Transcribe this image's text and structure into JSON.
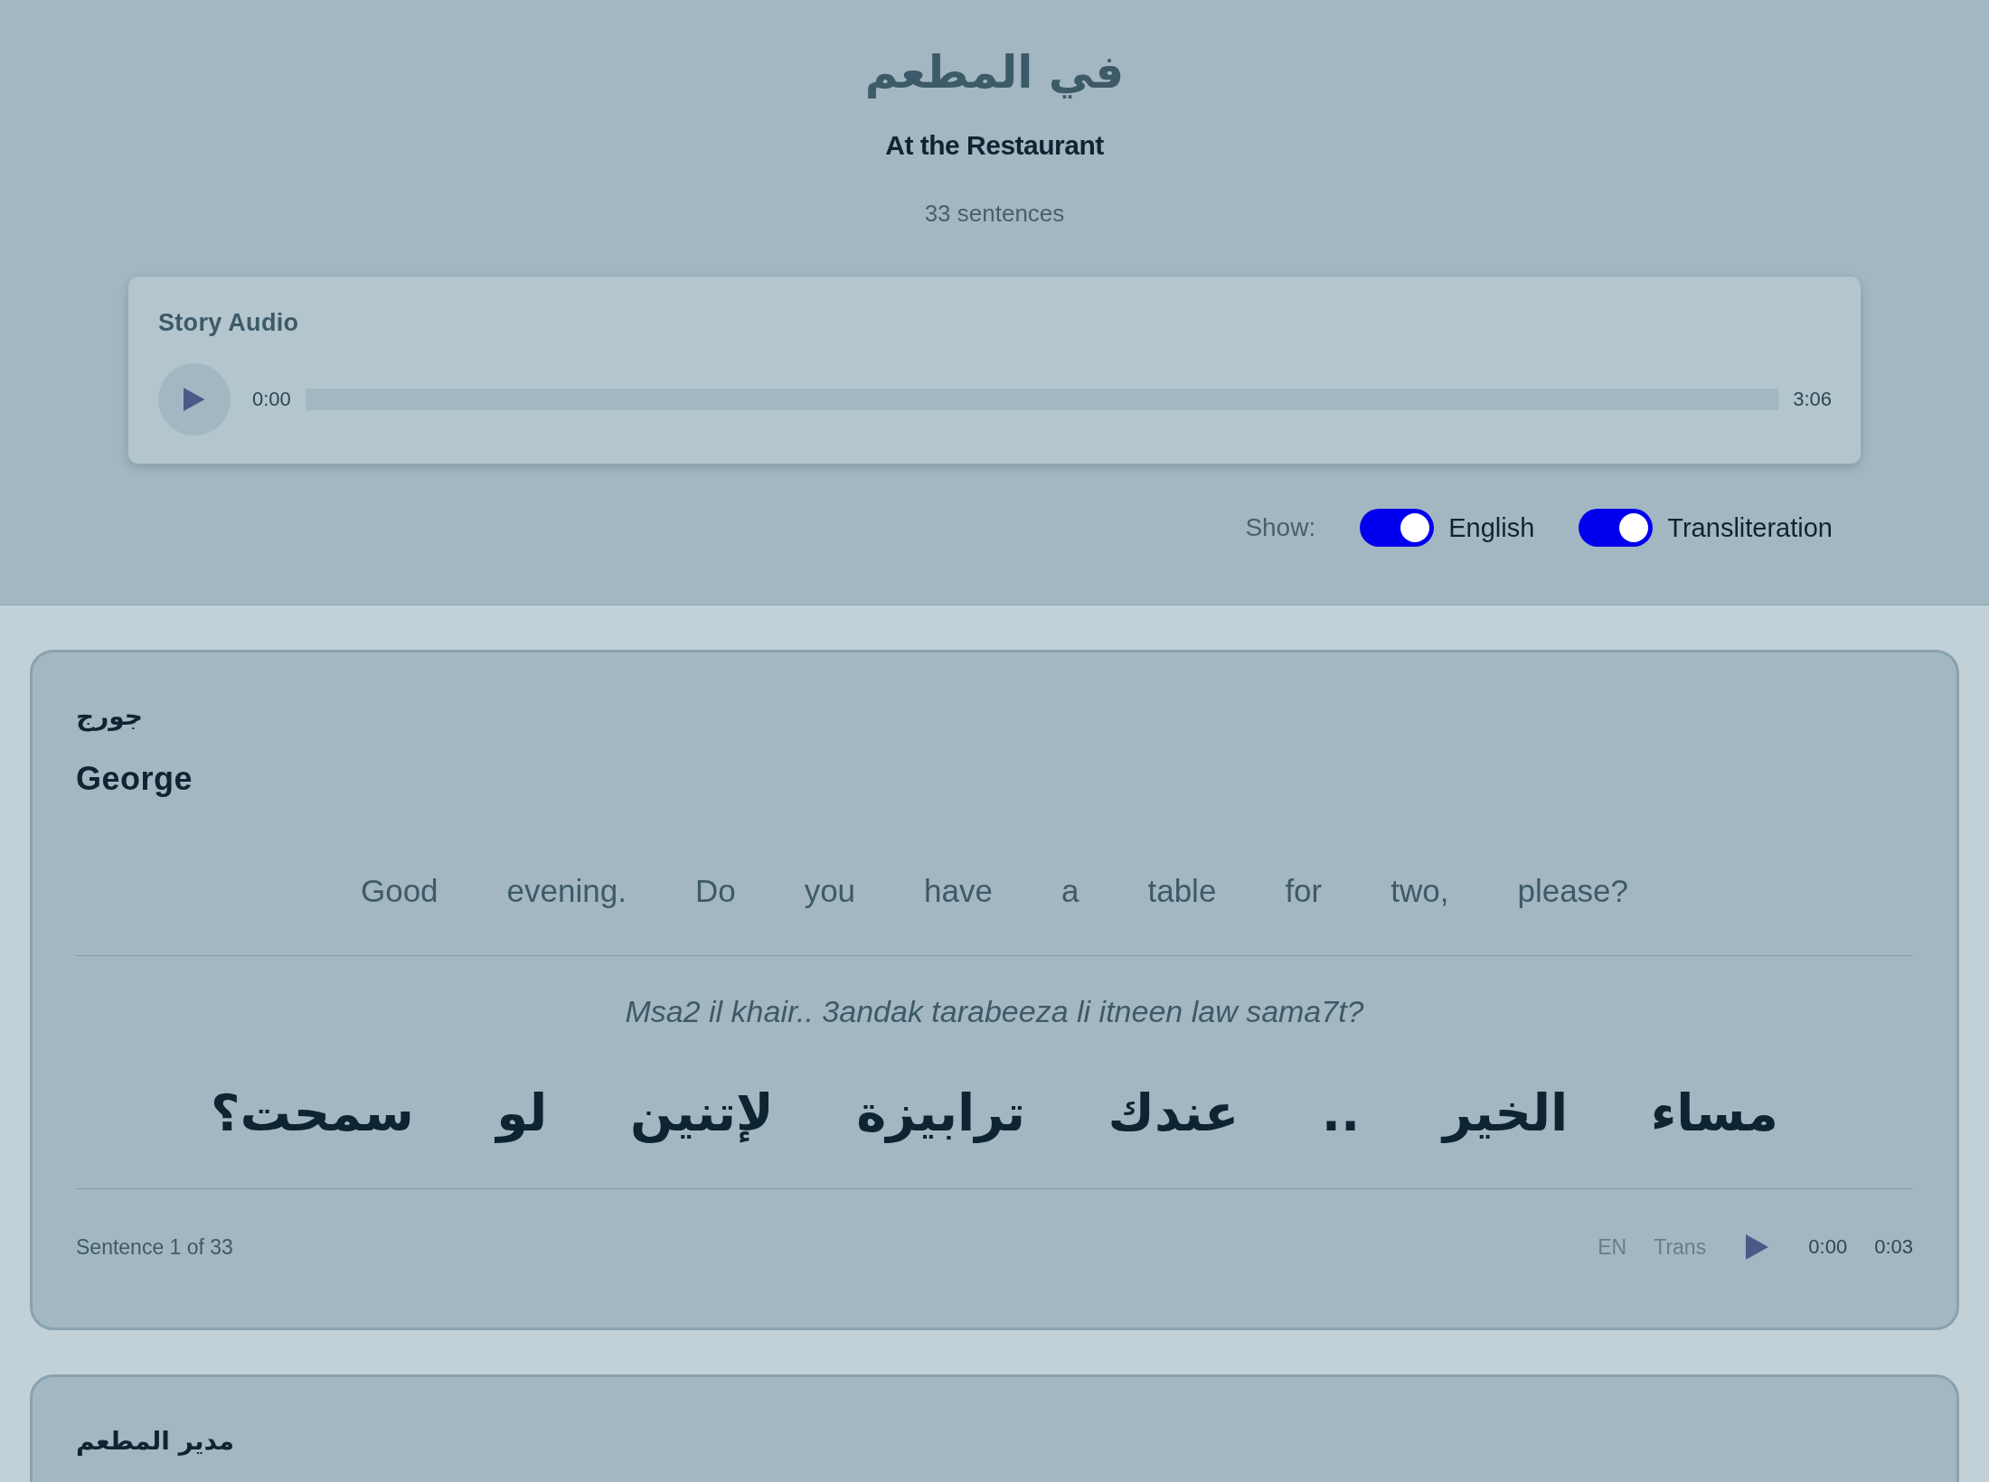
{
  "header": {
    "title_arabic": "في المطعم",
    "title": "At the Restaurant",
    "sentence_count": "33 sentences"
  },
  "story_audio": {
    "title": "Story Audio",
    "playing": false,
    "current_time": "0:00",
    "duration": "3:06"
  },
  "show_options": {
    "label": "Show:",
    "toggles": [
      {
        "label": "English",
        "on": true
      },
      {
        "label": "Transliteration",
        "on": true
      }
    ]
  },
  "sentences": [
    {
      "speaker_arabic": "جورج",
      "speaker": "George",
      "english_words": [
        "Good",
        "evening.",
        "Do",
        "you",
        "have",
        "a",
        "table",
        "for",
        "two,",
        "please?"
      ],
      "transliteration": "Msa2 il khair.. 3andak tarabeeza li itneen law sama7t?",
      "arabic_text": "مساء الخير .. عندك ترابيزة لإتنين لو سمحت؟",
      "counter": "Sentence 1 of 33",
      "audio": {
        "en_label": "EN",
        "trans_label": "Trans",
        "playing": false,
        "current_time": "0:00",
        "duration": "0:03"
      }
    },
    {
      "speaker_arabic": "مدير المطعم"
    }
  ]
}
